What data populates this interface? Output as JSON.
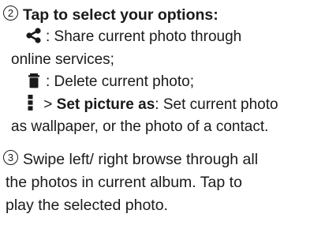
{
  "steps": [
    {
      "number": "2",
      "heading": "Tap to select your options:",
      "options": [
        {
          "icon": "share-icon",
          "line1": ": Share current photo through",
          "line2": "online services;"
        },
        {
          "icon": "trash-icon",
          "text": ": Delete current photo;"
        },
        {
          "icon": "more-vertical-icon",
          "prefix": " > ",
          "label": "Set picture as",
          "line1": ": Set current photo",
          "line2": "as wallpaper, or the photo of a contact."
        }
      ]
    },
    {
      "number": "3",
      "lines": [
        "Swipe left/ right browse through all",
        "the photos in current album. Tap to",
        "play the selected photo."
      ]
    }
  ]
}
